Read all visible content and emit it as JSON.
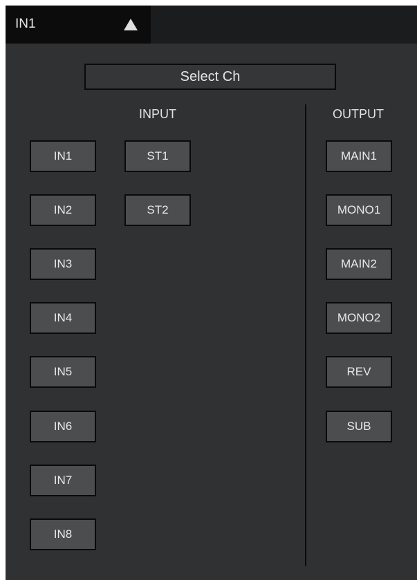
{
  "header": {
    "channel_label": "IN1",
    "arrow_icon": "triangle-up-icon"
  },
  "select_button_label": "Select Ch",
  "input_section": {
    "label": "INPUT",
    "mono_channels": [
      "IN1",
      "IN2",
      "IN3",
      "IN4",
      "IN5",
      "IN6",
      "IN7",
      "IN8"
    ],
    "stereo_channels": [
      "ST1",
      "ST2"
    ]
  },
  "output_section": {
    "label": "OUTPUT",
    "channels": [
      "MAIN1",
      "MONO1",
      "MAIN2",
      "MONO2",
      "REV",
      "SUB"
    ]
  },
  "colors": {
    "panel_bg": "#2f3132",
    "topbar_bg": "#1b1c1d",
    "button_bg": "#4b4d4f",
    "border": "#0a0a0a",
    "text": "#e9e9e9"
  }
}
